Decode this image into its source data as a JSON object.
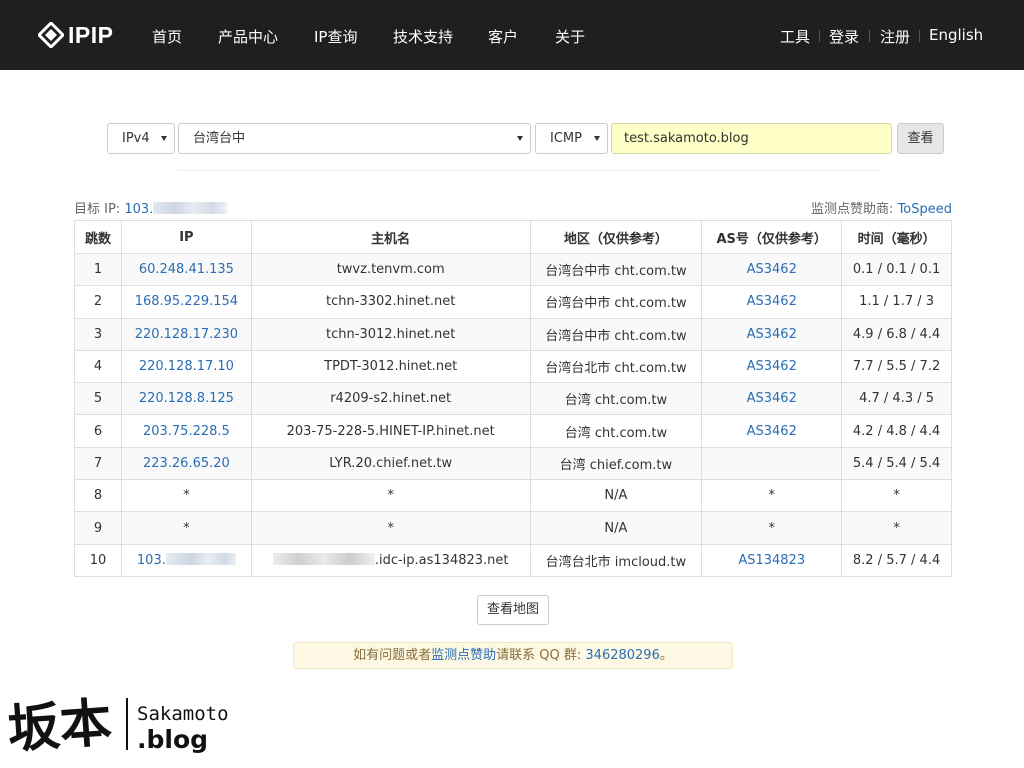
{
  "nav": {
    "logo_text": "IPIP",
    "items": [
      "首页",
      "产品中心",
      "IP查询",
      "技术支持",
      "客户",
      "关于"
    ],
    "right_items": [
      "工具",
      "登录",
      "注册",
      "English"
    ]
  },
  "form": {
    "ip_version": "IPv4",
    "location": "台湾台中",
    "protocol": "ICMP",
    "host": "test.sakamoto.blog",
    "submit_label": "查看"
  },
  "target": {
    "label": "目标 IP: ",
    "ip_prefix": "103."
  },
  "sponsor": {
    "label": "监测点赞助商: ",
    "name": "ToSpeed"
  },
  "table": {
    "headers": [
      "跳数",
      "IP",
      "主机名",
      "地区（仅供参考）",
      "AS号（仅供参考）",
      "时间（毫秒）"
    ],
    "rows": [
      {
        "hop": "1",
        "ip": "60.248.41.135",
        "host": "twvz.tenvm.com",
        "region": "台湾台中市 cht.com.tw",
        "as": "AS3462",
        "time": "0.1 / 0.1 / 0.1"
      },
      {
        "hop": "2",
        "ip": "168.95.229.154",
        "host": "tchn-3302.hinet.net",
        "region": "台湾台中市 cht.com.tw",
        "as": "AS3462",
        "time": "1.1 / 1.7 / 3"
      },
      {
        "hop": "3",
        "ip": "220.128.17.230",
        "host": "tchn-3012.hinet.net",
        "region": "台湾台中市 cht.com.tw",
        "as": "AS3462",
        "time": "4.9 / 6.8 / 4.4"
      },
      {
        "hop": "4",
        "ip": "220.128.17.10",
        "host": "TPDT-3012.hinet.net",
        "region": "台湾台北市 cht.com.tw",
        "as": "AS3462",
        "time": "7.7 / 5.5 / 7.2"
      },
      {
        "hop": "5",
        "ip": "220.128.8.125",
        "host": "r4209-s2.hinet.net",
        "region": "台湾 cht.com.tw",
        "as": "AS3462",
        "time": "4.7 / 4.3 / 5"
      },
      {
        "hop": "6",
        "ip": "203.75.228.5",
        "host": "203-75-228-5.HINET-IP.hinet.net",
        "region": "台湾 cht.com.tw",
        "as": "AS3462",
        "time": "4.2 / 4.8 / 4.4"
      },
      {
        "hop": "7",
        "ip": "223.26.65.20",
        "host": "LYR.20.chief.net.tw",
        "region": "台湾 chief.com.tw",
        "as": "",
        "time": "5.4 / 5.4 / 5.4"
      },
      {
        "hop": "8",
        "ip": "*",
        "host": "*",
        "region": "N/A",
        "as": "*",
        "time": "*"
      },
      {
        "hop": "9",
        "ip": "*",
        "host": "*",
        "region": "N/A",
        "as": "*",
        "time": "*"
      },
      {
        "hop": "10",
        "ip": "103.",
        "host": ".idc-ip.as134823.net",
        "region": "台湾台北市 imcloud.tw",
        "as": "AS134823",
        "time": "8.2 / 5.7 / 4.4"
      }
    ]
  },
  "map_button_label": "查看地图",
  "notice": {
    "prefix": "如有问题或者",
    "link_text": "监测点赞助",
    "middle": "请联系 QQ 群: ",
    "qq": "346280296",
    "suffix": "。"
  },
  "watermark": {
    "cn": "坂本",
    "line1": "Sakamoto",
    "line2": ".blog"
  }
}
